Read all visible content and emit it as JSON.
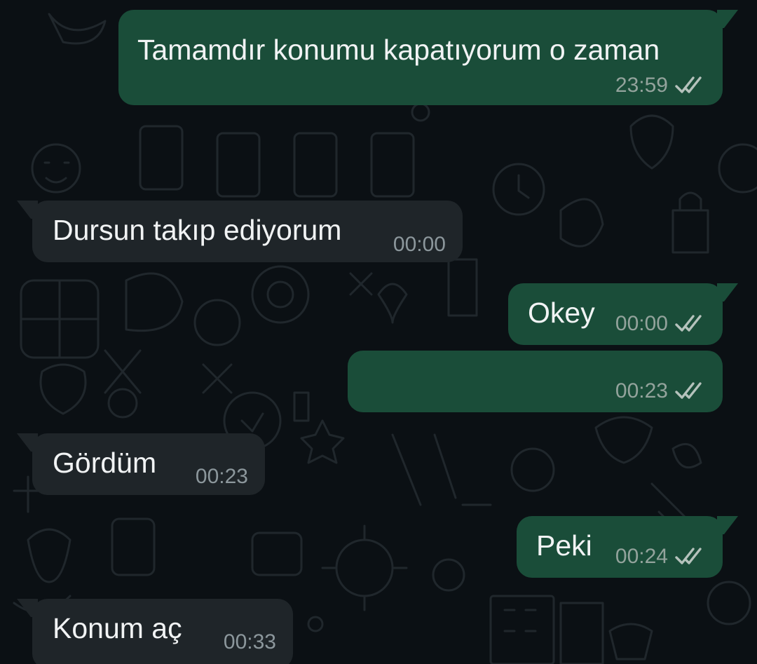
{
  "colors": {
    "background": "#0b1014",
    "outgoing_bubble": "#1a4d39",
    "incoming_bubble": "#1f2529",
    "timestamp": "#93a39c",
    "read_ticks": "#b5c2bc"
  },
  "messages": [
    {
      "direction": "outgoing",
      "text": "Tamamdır konumu kapatıyorum o zaman",
      "time": "23:59",
      "status_icon": "double-check-icon"
    },
    {
      "direction": "incoming",
      "text": "Dursun takıp ediyorum",
      "time": "00:00"
    },
    {
      "direction": "outgoing",
      "text": "Okey",
      "time": "00:00",
      "status_icon": "double-check-icon"
    },
    {
      "direction": "outgoing",
      "text": "",
      "time": "00:23",
      "status_icon": "double-check-icon"
    },
    {
      "direction": "incoming",
      "text": "Gördüm",
      "time": "00:23"
    },
    {
      "direction": "outgoing",
      "text": "Peki",
      "time": "00:24",
      "status_icon": "double-check-icon"
    },
    {
      "direction": "incoming",
      "text": "Konum aç",
      "time": "00:33"
    }
  ]
}
